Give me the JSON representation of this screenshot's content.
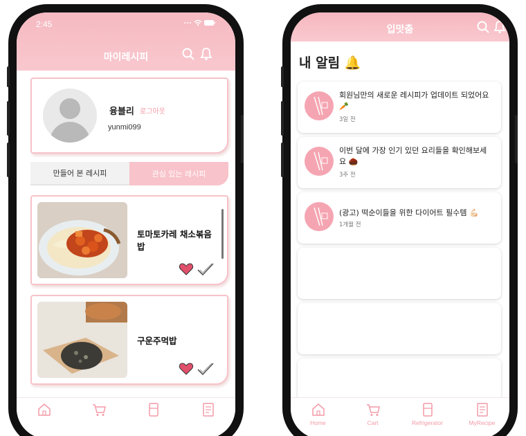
{
  "left_phone": {
    "status_time": "2:45",
    "title": "마이레시피",
    "profile": {
      "name": "융블리",
      "logout": "로그아웃",
      "user_id": "yunmi099"
    },
    "tabs": [
      {
        "label": "만들어 본 레시피"
      },
      {
        "label": "관심 있는 레시피"
      }
    ],
    "recipes": [
      {
        "name": "토마토카레 채소볶음밥"
      },
      {
        "name": "구운주먹밥"
      }
    ]
  },
  "right_phone": {
    "title": "입맛춤",
    "heading": "내 알림 🔔",
    "notifications": [
      {
        "text": "회원님만의 새로운 레시피가 업데이트 되었어요 🥕",
        "time": "3일 전"
      },
      {
        "text": "이번 달에 가장 인기 있던 요리들을 확인해보세요 🌰",
        "time": "3주 전"
      },
      {
        "text": "(광고) 떡순이들을 위한 다이어트 필수템 💪🏻",
        "time": "1개월 전"
      }
    ]
  },
  "bottom_nav": [
    {
      "label": "Home",
      "icon": "home-icon"
    },
    {
      "label": "Cart",
      "icon": "cart-icon"
    },
    {
      "label": "Refrigerator",
      "icon": "refrigerator-icon"
    },
    {
      "label": "MyRecipe",
      "icon": "recipe-icon"
    }
  ],
  "colors": {
    "accent": "#f7b9c1",
    "accent_text": "#f39aa7",
    "heart": "#e0506b"
  }
}
